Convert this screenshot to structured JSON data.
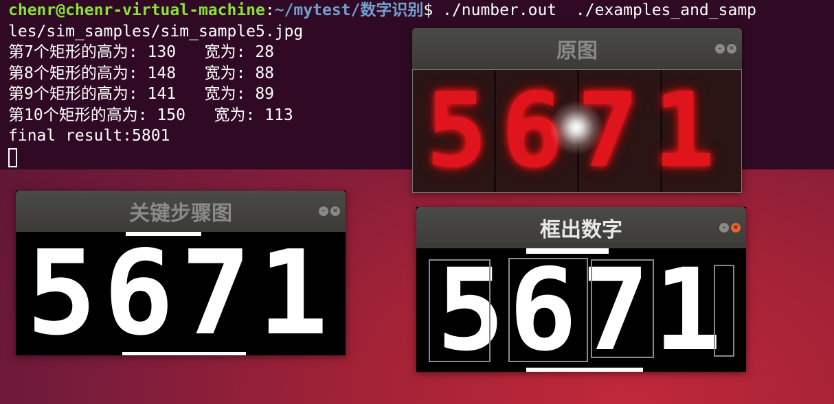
{
  "terminal": {
    "prompt_user": "chenr@chenr-virtual-machine",
    "prompt_sep": ":",
    "prompt_path": "~/mytest/数字识别",
    "command": "$ ./number.out  ./examples_and_samp",
    "command_wrap": "les/sim_samples/sim_sample5.jpg",
    "lines": [
      "第7个矩形的高为: 130   宽为: 28",
      "第8个矩形的高为: 148   宽为: 88",
      "第9个矩形的高为: 141   宽为: 89",
      "第10个矩形的高为: 150   宽为: 113",
      "final result:5801"
    ]
  },
  "windows": {
    "original": {
      "title": "原图",
      "digits": "5671"
    },
    "steps": {
      "title": "关键步骤图",
      "digits": "5671"
    },
    "boxed": {
      "title": "框出数字",
      "digits": "5671"
    }
  },
  "icons": {
    "minimize": "minimize-icon",
    "close": "close-icon"
  },
  "colors": {
    "terminal_bg": "#300a24",
    "prompt_user": "#8ae234",
    "prompt_path": "#729fcf",
    "close_active": "#e9632f",
    "digit_red": "#e0141c"
  }
}
